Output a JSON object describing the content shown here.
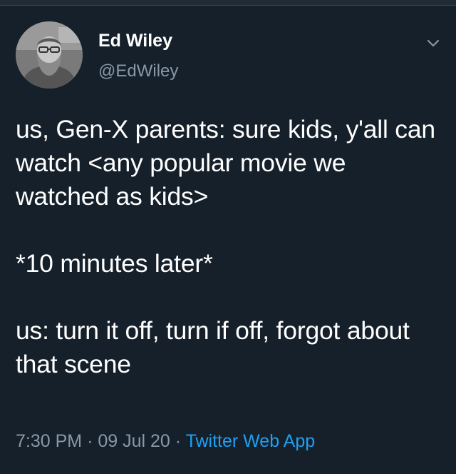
{
  "author": {
    "display_name": "Ed Wiley",
    "handle": "@EdWiley"
  },
  "tweet": {
    "paragraphs": [
      "us, Gen-X parents: sure kids, y'all can watch <any popular movie we watched as kids>",
      "*10 minutes later*",
      "us: turn it off, turn if off, forgot about that scene"
    ]
  },
  "meta": {
    "time": "7:30 PM",
    "separator": "·",
    "date": "09 Jul 20",
    "source": "Twitter Web App"
  },
  "icons": {
    "menu": "chevron-down-icon",
    "avatar": "profile-photo"
  },
  "colors": {
    "background": "#15202b",
    "text": "#ffffff",
    "secondary_text": "#8899a6",
    "link": "#1da1f2"
  }
}
